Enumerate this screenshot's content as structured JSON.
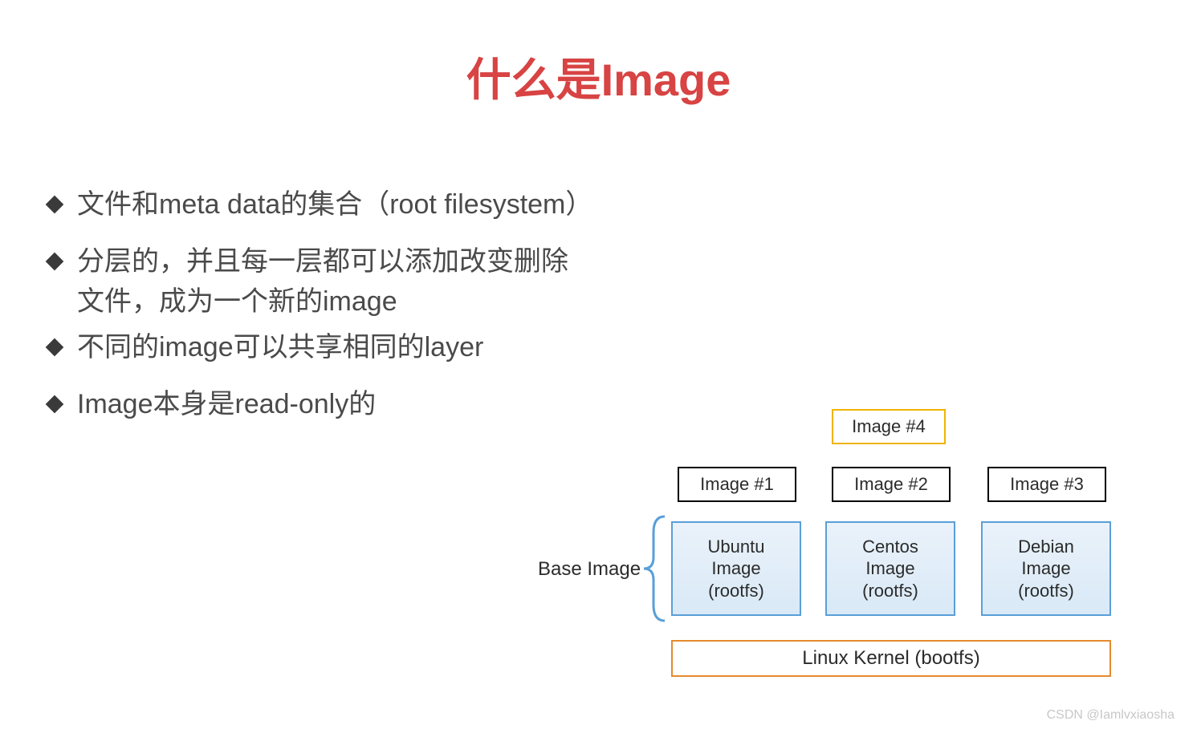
{
  "title": "什么是Image",
  "bullets": {
    "b1": "文件和meta data的集合（root filesystem）",
    "b2": "分层的，并且每一层都可以添加改变删除文件，成为一个新的image",
    "b3": "不同的image可以共享相同的layer",
    "b4": "Image本身是read-only的"
  },
  "diagram": {
    "base_label": "Base Image",
    "tags": {
      "img1": "Image #1",
      "img2": "Image #2",
      "img3": "Image #3",
      "img4": "Image #4"
    },
    "boxes": {
      "ubuntu": "Ubuntu\nImage\n(rootfs)",
      "centos": "Centos\nImage\n(rootfs)",
      "debian": "Debian\nImage\n(rootfs)"
    },
    "kernel": "Linux Kernel (bootfs)"
  },
  "watermark": "CSDN @Iamlvxiaosha"
}
